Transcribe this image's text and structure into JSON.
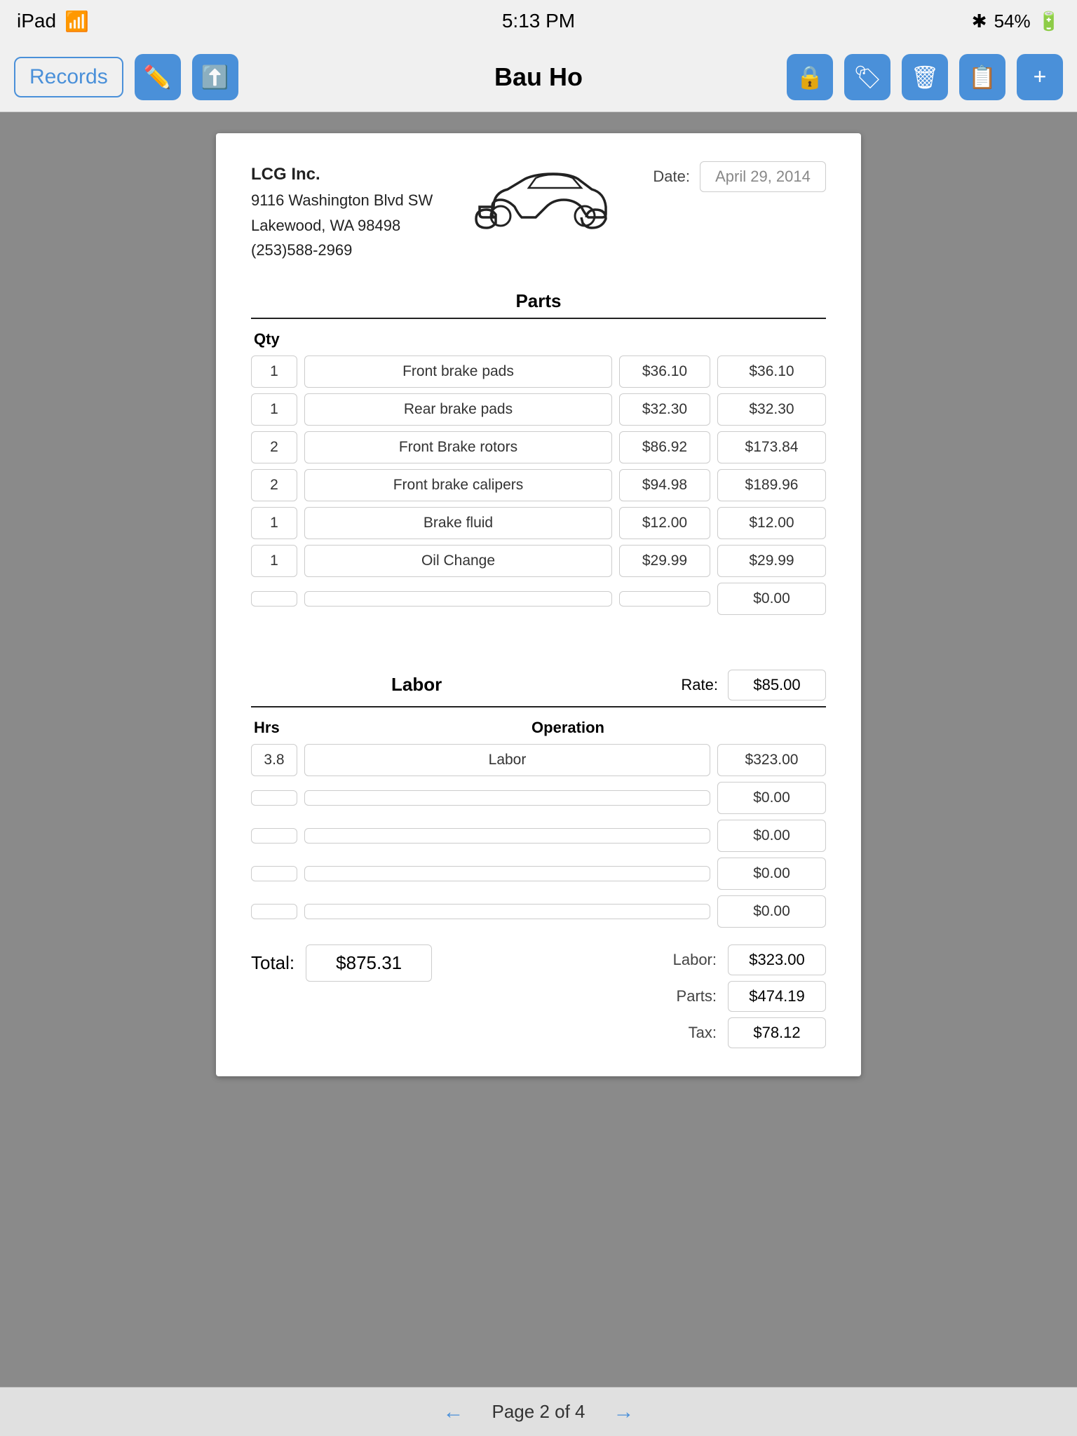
{
  "status": {
    "device": "iPad",
    "wifi": true,
    "time": "5:13 PM",
    "bluetooth": true,
    "battery": "54%"
  },
  "nav": {
    "records_label": "Records",
    "title": "Bau Ho",
    "page_indicator": "Page 2 of 4"
  },
  "document": {
    "company": {
      "name": "LCG Inc.",
      "address1": "9116 Washington Blvd SW",
      "address2": "Lakewood, WA  98498",
      "phone": "(253)588-2969"
    },
    "date_label": "Date:",
    "date_value": "April 29, 2014",
    "parts_title": "Parts",
    "qty_label": "Qty",
    "parts": [
      {
        "qty": "1",
        "desc": "Front brake pads",
        "price": "$36.10",
        "total": "$36.10"
      },
      {
        "qty": "1",
        "desc": "Rear brake pads",
        "price": "$32.30",
        "total": "$32.30"
      },
      {
        "qty": "2",
        "desc": "Front Brake rotors",
        "price": "$86.92",
        "total": "$173.84"
      },
      {
        "qty": "2",
        "desc": "Front brake calipers",
        "price": "$94.98",
        "total": "$189.96"
      },
      {
        "qty": "1",
        "desc": "Brake fluid",
        "price": "$12.00",
        "total": "$12.00"
      },
      {
        "qty": "1",
        "desc": "Oil Change",
        "price": "$29.99",
        "total": "$29.99"
      },
      {
        "qty": "",
        "desc": "",
        "price": "",
        "total": "$0.00"
      }
    ],
    "labor_title": "Labor",
    "rate_label": "Rate:",
    "rate_value": "$85.00",
    "hrs_label": "Hrs",
    "op_label": "Operation",
    "labor_rows": [
      {
        "hrs": "3.8",
        "op": "Labor",
        "total": "$323.00"
      },
      {
        "hrs": "",
        "op": "",
        "total": "$0.00"
      },
      {
        "hrs": "",
        "op": "",
        "total": "$0.00"
      },
      {
        "hrs": "",
        "op": "",
        "total": "$0.00"
      },
      {
        "hrs": "",
        "op": "",
        "total": "$0.00"
      }
    ],
    "totals": {
      "total_label": "Total:",
      "total_value": "$875.31",
      "labor_label": "Labor:",
      "labor_value": "$323.00",
      "parts_label": "Parts:",
      "parts_value": "$474.19",
      "tax_label": "Tax:",
      "tax_value": "$78.12"
    }
  }
}
